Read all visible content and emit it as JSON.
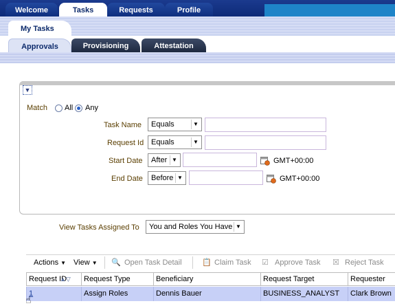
{
  "top_tabs": [
    {
      "label": "Welcome"
    },
    {
      "label": "Tasks"
    },
    {
      "label": "Requests"
    },
    {
      "label": "Profile"
    }
  ],
  "my_tasks": {
    "label": "My Tasks"
  },
  "sub_tabs": [
    {
      "label": "Approvals"
    },
    {
      "label": "Provisioning"
    },
    {
      "label": "Attestation"
    }
  ],
  "search": {
    "disclose_icon": "chevron-down-icon",
    "match_label": "Match",
    "match_all": "All",
    "match_any": "Any",
    "task_name": {
      "label": "Task Name",
      "operator": "Equals",
      "value": ""
    },
    "request_id": {
      "label": "Request Id",
      "operator": "Equals",
      "value": ""
    },
    "start_date": {
      "label": "Start Date",
      "operator": "After",
      "value": "",
      "tz": "GMT+00:00"
    },
    "end_date": {
      "label": "End Date",
      "operator": "Before",
      "value": "",
      "tz": "GMT+00:00"
    }
  },
  "assigned": {
    "label": "View Tasks Assigned To",
    "value": "You and Roles You Have"
  },
  "toolbar": {
    "actions": "Actions",
    "view": "View",
    "open_task_detail": "Open Task Detail",
    "claim_task": "Claim Task",
    "approve_task": "Approve Task",
    "reject_task": "Reject Task"
  },
  "table": {
    "columns": [
      "Request ID",
      "Request Type",
      "Beneficiary",
      "Request Target",
      "Requester"
    ],
    "rows": [
      [
        "1",
        "Assign Roles",
        "Dennis Bauer",
        "BUSINESS_ANALYST",
        "Clark Brown"
      ]
    ]
  },
  "colors": {
    "accent": "#0c2a6b",
    "selected_row": "#c7d0f7",
    "label": "#5a3e00"
  }
}
